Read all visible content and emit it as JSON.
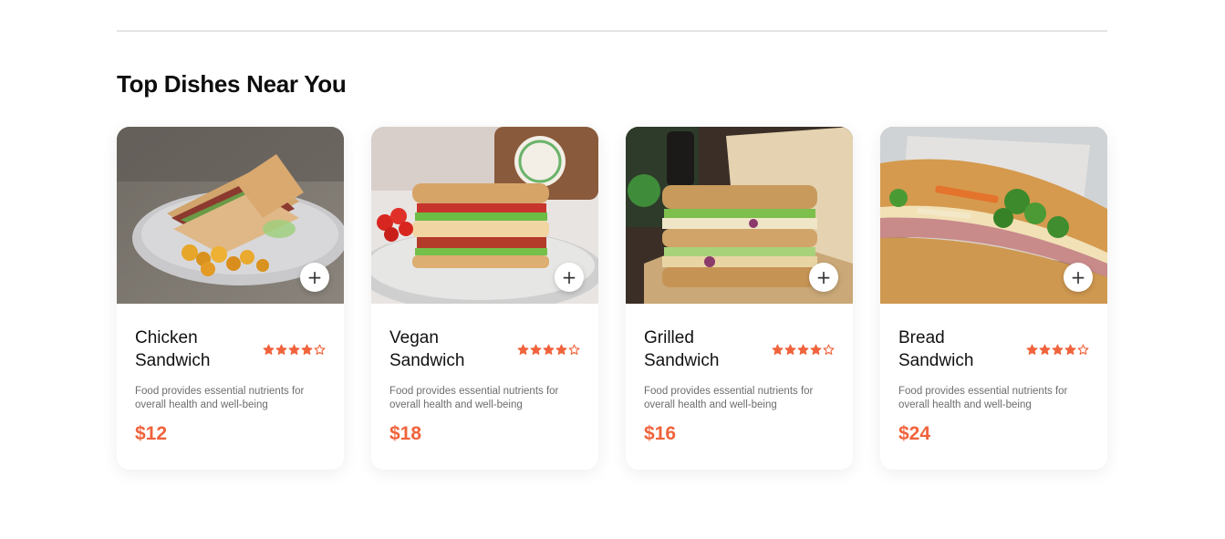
{
  "section": {
    "title": "Top Dishes Near You"
  },
  "colors": {
    "accent": "#f0633c",
    "star": "#f0633c",
    "text": "#111111",
    "muted": "#6d6d6d"
  },
  "dishes": [
    {
      "name": "Chicken Sandwich",
      "description": "Food provides essential nutrients for overall health and well-being",
      "price": "$12",
      "rating": 4,
      "rating_max": 5,
      "image": "chicken-sandwich-photo"
    },
    {
      "name": "Vegan Sandwich",
      "description": "Food provides essential nutrients for overall health and well-being",
      "price": "$18",
      "rating": 4,
      "rating_max": 5,
      "image": "vegan-sandwich-photo"
    },
    {
      "name": "Grilled Sandwich",
      "description": "Food provides essential nutrients for overall health and well-being",
      "price": "$16",
      "rating": 4,
      "rating_max": 5,
      "image": "grilled-sandwich-photo"
    },
    {
      "name": "Bread Sandwich",
      "description": "Food provides essential nutrients for overall health and well-being",
      "price": "$24",
      "rating": 4,
      "rating_max": 5,
      "image": "bread-sandwich-photo"
    }
  ],
  "icons": {
    "add": "plus-icon",
    "star_filled": "star-filled-icon",
    "star_empty": "star-outline-icon"
  }
}
